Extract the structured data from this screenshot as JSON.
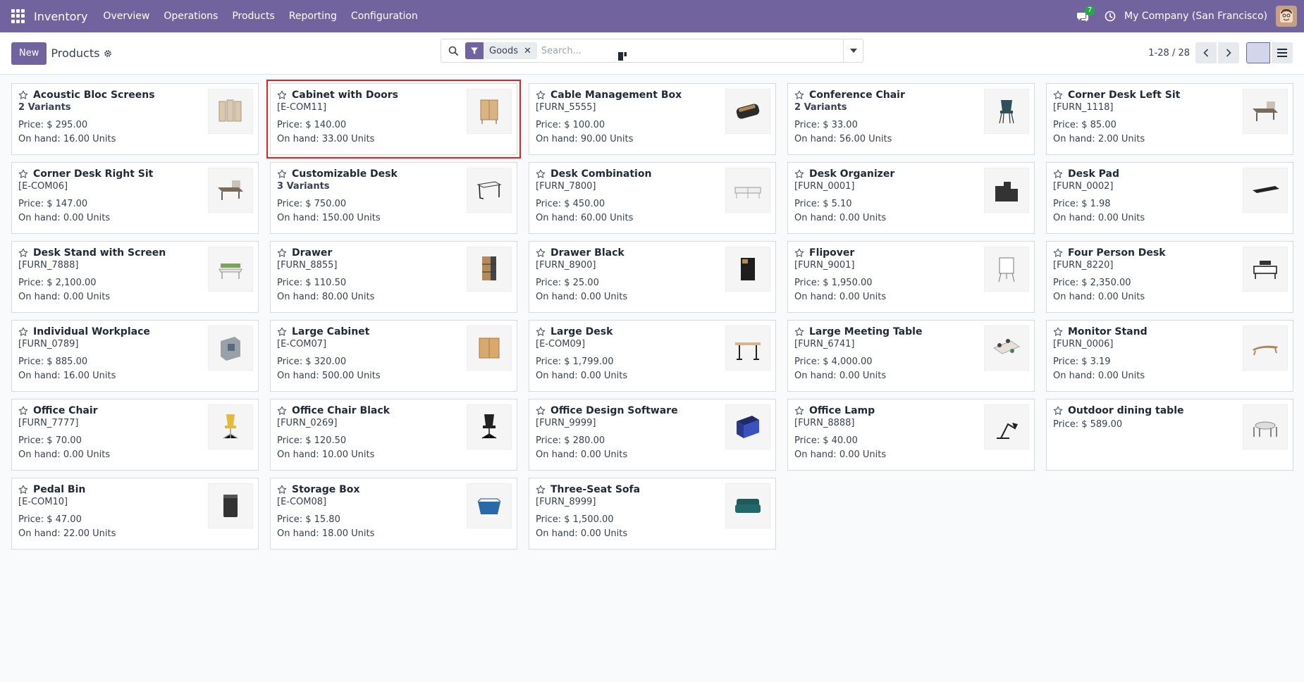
{
  "navbar": {
    "app_name": "Inventory",
    "menu": [
      "Overview",
      "Operations",
      "Products",
      "Reporting",
      "Configuration"
    ],
    "chat_count": "7",
    "company": "My Company (San Francisco)"
  },
  "control_panel": {
    "new_label": "New",
    "title": "Products",
    "facet_label": "Goods",
    "search_placeholder": "Search...",
    "pager": "1-28 / 28"
  },
  "colors": {
    "brand": "#71639e",
    "highlight": "#e02424"
  },
  "products": [
    {
      "name": "Acoustic Bloc Screens",
      "ref": "",
      "variants": "2 Variants",
      "price": "Price: $ 295.00",
      "onhand": "On hand: 16.00 Units",
      "icon": "acoustic-screen-icon"
    },
    {
      "name": "Cabinet with Doors",
      "ref": "[E-COM11]",
      "variants": "",
      "price": "Price: $ 140.00",
      "onhand": "On hand: 33.00 Units",
      "icon": "cabinet-icon",
      "highlighted": true
    },
    {
      "name": "Cable Management Box",
      "ref": "[FURN_5555]",
      "variants": "",
      "price": "Price: $ 100.00",
      "onhand": "On hand: 90.00 Units",
      "icon": "cable-box-icon"
    },
    {
      "name": "Conference Chair",
      "ref": "",
      "variants": "2 Variants",
      "price": "Price: $ 33.00",
      "onhand": "On hand: 56.00 Units",
      "icon": "chair-icon"
    },
    {
      "name": "Corner Desk Left Sit",
      "ref": "[FURN_1118]",
      "variants": "",
      "price": "Price: $ 85.00",
      "onhand": "On hand: 2.00 Units",
      "icon": "corner-desk-icon"
    },
    {
      "name": "Corner Desk Right Sit",
      "ref": "[E-COM06]",
      "variants": "",
      "price": "Price: $ 147.00",
      "onhand": "On hand: 0.00 Units",
      "icon": "corner-desk-icon"
    },
    {
      "name": "Customizable Desk",
      "ref": "",
      "variants": "3 Variants",
      "price": "Price: $ 750.00",
      "onhand": "On hand: 150.00 Units",
      "icon": "desk-icon"
    },
    {
      "name": "Desk Combination",
      "ref": "[FURN_7800]",
      "variants": "",
      "price": "Price: $ 450.00",
      "onhand": "On hand: 60.00 Units",
      "icon": "desk-combination-icon"
    },
    {
      "name": "Desk Organizer",
      "ref": "[FURN_0001]",
      "variants": "",
      "price": "Price: $ 5.10",
      "onhand": "On hand: 0.00 Units",
      "icon": "organizer-icon"
    },
    {
      "name": "Desk Pad",
      "ref": "[FURN_0002]",
      "variants": "",
      "price": "Price: $ 1.98",
      "onhand": "On hand: 0.00 Units",
      "icon": "desk-pad-icon"
    },
    {
      "name": "Desk Stand with Screen",
      "ref": "[FURN_7888]",
      "variants": "",
      "price": "Price: $ 2,100.00",
      "onhand": "On hand: 0.00 Units",
      "icon": "desk-stand-icon"
    },
    {
      "name": "Drawer",
      "ref": "[FURN_8855]",
      "variants": "",
      "price": "Price: $ 110.50",
      "onhand": "On hand: 80.00 Units",
      "icon": "drawer-icon"
    },
    {
      "name": "Drawer Black",
      "ref": "[FURN_8900]",
      "variants": "",
      "price": "Price: $ 25.00",
      "onhand": "On hand: 0.00 Units",
      "icon": "drawer-black-icon"
    },
    {
      "name": "Flipover",
      "ref": "[FURN_9001]",
      "variants": "",
      "price": "Price: $ 1,950.00",
      "onhand": "On hand: 0.00 Units",
      "icon": "flipchart-icon"
    },
    {
      "name": "Four Person Desk",
      "ref": "[FURN_8220]",
      "variants": "",
      "price": "Price: $ 2,350.00",
      "onhand": "On hand: 0.00 Units",
      "icon": "four-person-desk-icon"
    },
    {
      "name": "Individual Workplace",
      "ref": "[FURN_0789]",
      "variants": "",
      "price": "Price: $ 885.00",
      "onhand": "On hand: 16.00 Units",
      "icon": "workplace-icon"
    },
    {
      "name": "Large Cabinet",
      "ref": "[E-COM07]",
      "variants": "",
      "price": "Price: $ 320.00",
      "onhand": "On hand: 500.00 Units",
      "icon": "large-cabinet-icon"
    },
    {
      "name": "Large Desk",
      "ref": "[E-COM09]",
      "variants": "",
      "price": "Price: $ 1,799.00",
      "onhand": "On hand: 0.00 Units",
      "icon": "large-desk-icon"
    },
    {
      "name": "Large Meeting Table",
      "ref": "[FURN_6741]",
      "variants": "",
      "price": "Price: $ 4,000.00",
      "onhand": "On hand: 0.00 Units",
      "icon": "meeting-table-icon"
    },
    {
      "name": "Monitor Stand",
      "ref": "[FURN_0006]",
      "variants": "",
      "price": "Price: $ 3.19",
      "onhand": "On hand: 0.00 Units",
      "icon": "monitor-stand-icon"
    },
    {
      "name": "Office Chair",
      "ref": "[FURN_7777]",
      "variants": "",
      "price": "Price: $ 70.00",
      "onhand": "On hand: 0.00 Units",
      "icon": "office-chair-icon"
    },
    {
      "name": "Office Chair Black",
      "ref": "[FURN_0269]",
      "variants": "",
      "price": "Price: $ 120.50",
      "onhand": "On hand: 10.00 Units",
      "icon": "office-chair-black-icon"
    },
    {
      "name": "Office Design Software",
      "ref": "[FURN_9999]",
      "variants": "",
      "price": "Price: $ 280.00",
      "onhand": "On hand: 0.00 Units",
      "icon": "software-box-icon"
    },
    {
      "name": "Office Lamp",
      "ref": "[FURN_8888]",
      "variants": "",
      "price": "Price: $ 40.00",
      "onhand": "On hand: 0.00 Units",
      "icon": "lamp-icon"
    },
    {
      "name": "Outdoor dining table",
      "ref": "",
      "variants": "",
      "price": "Price: $ 589.00",
      "onhand": "",
      "icon": "dining-table-icon"
    },
    {
      "name": "Pedal Bin",
      "ref": "[E-COM10]",
      "variants": "",
      "price": "Price: $ 47.00",
      "onhand": "On hand: 22.00 Units",
      "icon": "pedal-bin-icon"
    },
    {
      "name": "Storage Box",
      "ref": "[E-COM08]",
      "variants": "",
      "price": "Price: $ 15.80",
      "onhand": "On hand: 18.00 Units",
      "icon": "storage-box-icon"
    },
    {
      "name": "Three-Seat Sofa",
      "ref": "[FURN_8999]",
      "variants": "",
      "price": "Price: $ 1,500.00",
      "onhand": "On hand: 0.00 Units",
      "icon": "sofa-icon"
    }
  ]
}
